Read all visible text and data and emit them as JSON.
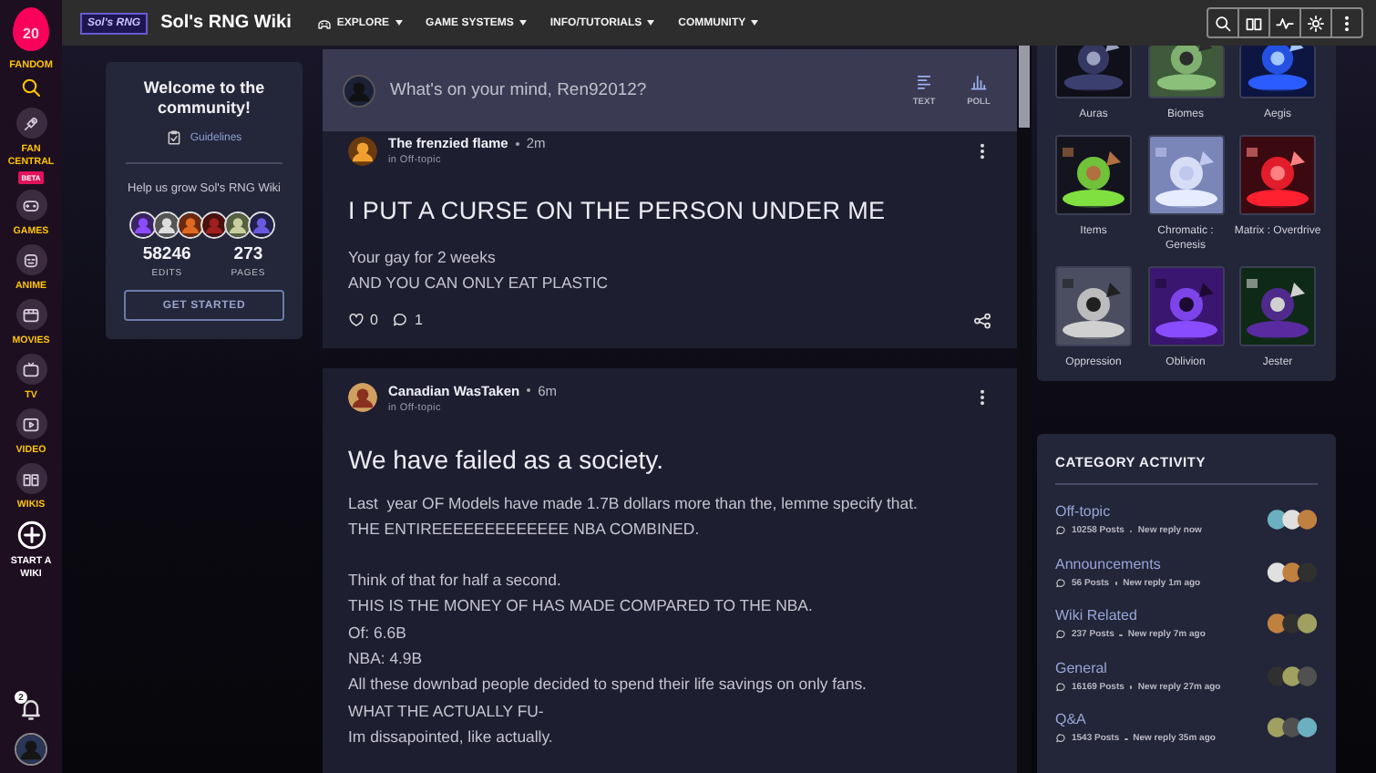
{
  "rail": {
    "badge_count": "20",
    "brand": "FANDOM",
    "items": [
      {
        "kind": "fan",
        "label": "FAN CENTRAL",
        "tag": "BETA"
      },
      {
        "kind": "games",
        "label": "GAMES"
      },
      {
        "kind": "anime",
        "label": "ANIME"
      },
      {
        "kind": "movies",
        "label": "MOVIES"
      },
      {
        "kind": "tv",
        "label": "TV"
      },
      {
        "kind": "video",
        "label": "VIDEO"
      },
      {
        "kind": "wikis",
        "label": "WIKIS"
      },
      {
        "kind": "start",
        "label": "START A WIKI"
      }
    ],
    "notifications": "2"
  },
  "header": {
    "logo": "Sol's RNG",
    "wiki_name": "Sol's RNG Wiki",
    "nav": [
      {
        "label": "EXPLORE",
        "kind": "explore"
      },
      {
        "label": "GAME SYSTEMS",
        "kind": "menu"
      },
      {
        "label": "INFO/TUTORIALS",
        "kind": "menu"
      },
      {
        "label": "COMMUNITY",
        "kind": "menu"
      }
    ]
  },
  "welcome": {
    "title": "Welcome to the community!",
    "guidelines": "Guidelines",
    "prompt": "Help us grow Sol's RNG Wiki",
    "stats": [
      {
        "value": "58246",
        "label": "EDITS"
      },
      {
        "value": "273",
        "label": "PAGES"
      }
    ],
    "button": "GET STARTED"
  },
  "composer": {
    "placeholder": "What's on your mind, Ren92012?",
    "actions": [
      {
        "label": "TEXT",
        "kind": "text"
      },
      {
        "label": "POLL",
        "kind": "poll"
      }
    ]
  },
  "posts": [
    {
      "author": "The frenzied flame",
      "time": "2m",
      "category": "in Off-topic",
      "title": "I PUT A CURSE ON THE PERSON UNDER ME",
      "paragraphs": [
        [
          "Your gay for 2 weeks",
          "AND YOU CAN ONLY EAT PLASTIC"
        ]
      ],
      "likes": "0",
      "comments": "1"
    },
    {
      "author": "Canadian WasTaken",
      "time": "6m",
      "category": "in Off-topic",
      "title": "We have failed as a society.",
      "paragraphs": [
        [
          "Last  year OF Models have made 1.7B dollars more than the, lemme specify that.",
          "THE ENTIREEEEEEEEEEEEE NBA COMBINED."
        ],
        [
          "Think of that for half a second.",
          "THIS IS THE MONEY OF HAS MADE COMPARED TO THE NBA.",
          "Of: 6.6B",
          "NBA: 4.9B",
          "All these downbad people decided to spend their life savings on only fans.",
          "WHAT THE ACTUALLY FU-",
          "Im dissapointed, like actually."
        ]
      ]
    }
  ],
  "tiles": [
    {
      "label": "Auras"
    },
    {
      "label": "Biomes"
    },
    {
      "label": "Aegis"
    },
    {
      "label": "Items"
    },
    {
      "label": "Chromatic : Genesis"
    },
    {
      "label": "Matrix : Overdrive"
    },
    {
      "label": "Oppression"
    },
    {
      "label": "Oblivion"
    },
    {
      "label": "Jester"
    }
  ],
  "category_activity": {
    "title": "CATEGORY ACTIVITY",
    "categories": [
      {
        "name": "Off-topic",
        "posts": "10258 Posts",
        "reply": "New reply now"
      },
      {
        "name": "Announcements",
        "posts": "56 Posts",
        "reply": "New reply 1m ago"
      },
      {
        "name": "Wiki Related",
        "posts": "237 Posts",
        "reply": "New reply 7m ago"
      },
      {
        "name": "General",
        "posts": "16169 Posts",
        "reply": "New reply 27m ago"
      },
      {
        "name": "Q&A",
        "posts": "1543 Posts",
        "reply": "New reply 35m ago"
      }
    ]
  }
}
